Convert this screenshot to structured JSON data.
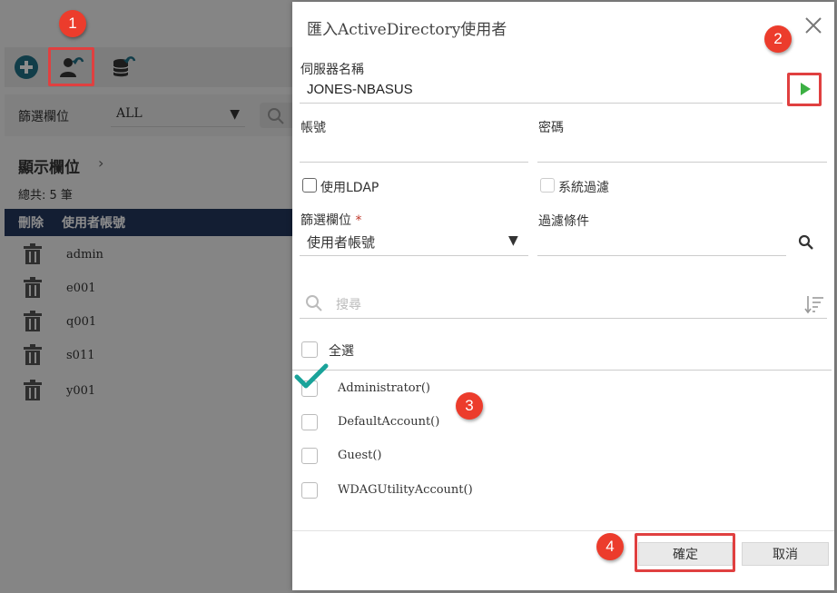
{
  "background": {
    "toolbar_icons": [
      "plus-circle-icon",
      "import-user-icon",
      "database-import-icon"
    ],
    "filter_label": "篩選欄位",
    "filter_value": "ALL",
    "section_title": "顯示欄位",
    "total_text": "總共: 5 筆",
    "table_headers": [
      "刪除",
      "使用者帳號"
    ],
    "users": [
      "admin",
      "e001",
      "q001",
      "s011",
      "y001"
    ]
  },
  "dialog": {
    "title": "匯入ActiveDirectory使用者",
    "server_label": "伺服器名稱",
    "server_value": "JONES-NBASUS",
    "account_label": "帳號",
    "password_label": "密碼",
    "use_ldap_label": "使用LDAP",
    "system_filter_label": "系統過濾",
    "filter_field_label": "篩選欄位",
    "filter_field_value": "使用者帳號",
    "filter_condition_label": "過濾條件",
    "search_placeholder": "搜尋",
    "select_all_label": "全選",
    "accounts": [
      "Administrator()",
      "DefaultAccount()",
      "Guest()",
      "WDAGUtilityAccount()"
    ],
    "confirm_label": "確定",
    "cancel_label": "取消"
  },
  "annotations": {
    "steps": [
      "1",
      "2",
      "3",
      "4"
    ]
  },
  "colors": {
    "accent_navy": "#24375e",
    "teal": "#1f7a8c",
    "play_green": "#3cb043",
    "highlight_red": "#e04040",
    "badge_red": "#ec3c2c",
    "check_teal": "#1aa39a"
  }
}
